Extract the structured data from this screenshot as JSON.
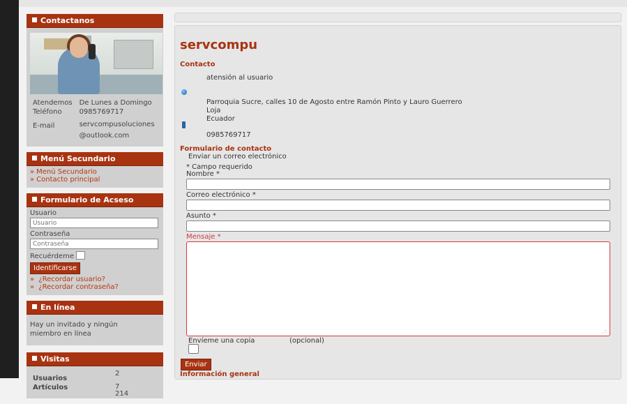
{
  "sidebar": {
    "contact": {
      "title": "Contactanos",
      "rows": [
        {
          "label": "Atendemos",
          "value": "De Lunes a Domingo"
        },
        {
          "label": "Teléfono",
          "value": "0985769717"
        },
        {
          "label": "E-mail",
          "value_line1": "servcompusoluciones",
          "value_line2": "@outlook.com"
        }
      ]
    },
    "menu": {
      "title": "Menú Secundario",
      "items": [
        "Menú Secundario",
        "Contacto principal"
      ]
    },
    "login": {
      "title": "Formulario de Acseso",
      "username_label": "Usuario",
      "username_placeholder": "Usuario",
      "password_label": "Contraseña",
      "password_placeholder": "Contraseña",
      "remember_label": "Recuérdeme",
      "submit_label": "Identificarse",
      "links": [
        "¿Recordar usuario?",
        "¿Recordar contraseña?"
      ]
    },
    "online": {
      "title": "En línea",
      "text": "Hay un invitado y ningún miembro en línea"
    },
    "visits": {
      "title": "Visitas",
      "rows": [
        {
          "label": "Usuarios",
          "value": "2"
        },
        {
          "label": "Artículos",
          "value": "7"
        }
      ],
      "extra_value": "214"
    }
  },
  "main": {
    "title": "servcompu",
    "contact_section": "Contacto",
    "position": "atensión al usuario",
    "address_line1": "Parroquia Sucre, calles 10 de Agosto entre Ramón Pinto y Lauro Guerrero",
    "address_line2": "Loja",
    "address_line3": "Ecuador",
    "phone": "0985769717",
    "form_section": "Formulario de contacto",
    "form_subtitle": "Enviar un correo electrónico",
    "required_note": "* Campo requerido",
    "name_label": "Nombre *",
    "email_label": "Correo electrónico *",
    "subject_label": "Asunto *",
    "message_label": "Mensaje *",
    "copy_label": "Envíeme una copia",
    "copy_optional": "(opcional)",
    "send_label": "Enviar",
    "info_section": "Información general"
  },
  "colors": {
    "accent": "#a83311",
    "error": "#d23a3a"
  }
}
